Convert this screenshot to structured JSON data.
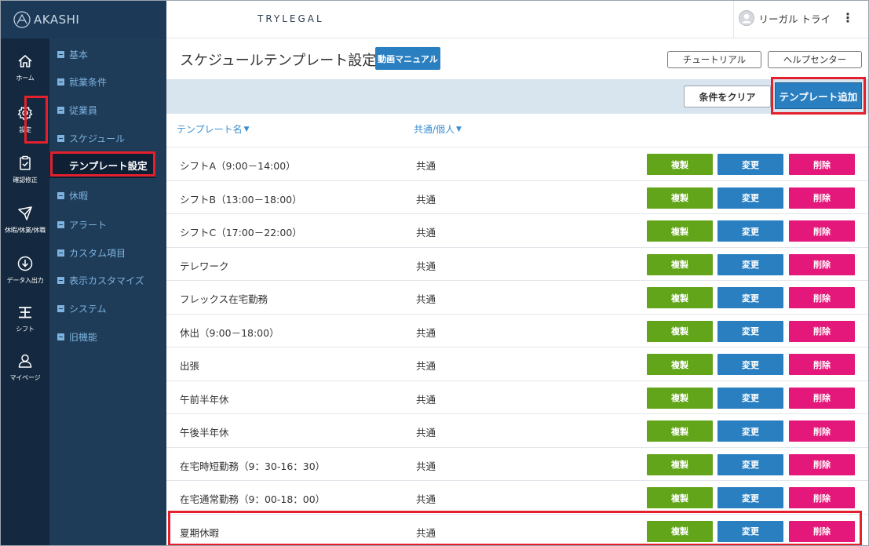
{
  "brand": {
    "name": "AKASHI"
  },
  "header": {
    "tenant": "TRYLEGAL",
    "user_name": "リーガル トライ",
    "menu_glyph": "⋮"
  },
  "rail": [
    {
      "icon": "home-icon",
      "label": "ホーム"
    },
    {
      "icon": "gear-icon",
      "label": "設定"
    },
    {
      "icon": "clipboard-check-icon",
      "label": "確認修正"
    },
    {
      "icon": "plane-icon",
      "label": "休暇/休業/休職"
    },
    {
      "icon": "download-circle-icon",
      "label": "データ入出力"
    },
    {
      "icon": "shift-icon",
      "label": "シフト"
    },
    {
      "icon": "person-icon",
      "label": "マイページ"
    }
  ],
  "submenu": {
    "items": [
      "基本",
      "就業条件",
      "従業員",
      "スケジュール"
    ],
    "active": "テンプレート設定",
    "items_after": [
      "休暇",
      "アラート",
      "カスタム項目",
      "表示カスタマイズ",
      "システム",
      "旧機能"
    ]
  },
  "page": {
    "title": "スケジュールテンプレート設定",
    "video_manual": "動画マニュアル",
    "tutorial": "チュートリアル",
    "help_center": "ヘルプセンター",
    "clear_conditions": "条件をクリア",
    "add_template": "テンプレート追加"
  },
  "table": {
    "headers": {
      "name": "テンプレート名",
      "type": "共通/個人",
      "caret": "▼"
    },
    "actions": {
      "copy": "複製",
      "edit": "変更",
      "delete": "削除"
    },
    "rows": [
      {
        "name": "シフトA（9:00－14:00）",
        "type": "共通"
      },
      {
        "name": "シフトB（13:00－18:00）",
        "type": "共通"
      },
      {
        "name": "シフトC（17:00－22:00）",
        "type": "共通"
      },
      {
        "name": "テレワーク",
        "type": "共通"
      },
      {
        "name": "フレックス在宅勤務",
        "type": "共通"
      },
      {
        "name": "休出（9:00－18:00）",
        "type": "共通"
      },
      {
        "name": "出張",
        "type": "共通"
      },
      {
        "name": "午前半年休",
        "type": "共通"
      },
      {
        "name": "午後半年休",
        "type": "共通"
      },
      {
        "name": "在宅時短勤務（9：30-16：30）",
        "type": "共通"
      },
      {
        "name": "在宅通常勤務（9：00-18：00）",
        "type": "共通"
      },
      {
        "name": "夏期休暇",
        "type": "共通"
      }
    ]
  },
  "colors": {
    "rail_bg": "#14293f",
    "submenu_bg": "#1e3b58",
    "accent_blue": "#2a7fc0",
    "copy_green": "#63a51a",
    "delete_pink": "#e4177a",
    "highlight_red": "#e3202b"
  }
}
